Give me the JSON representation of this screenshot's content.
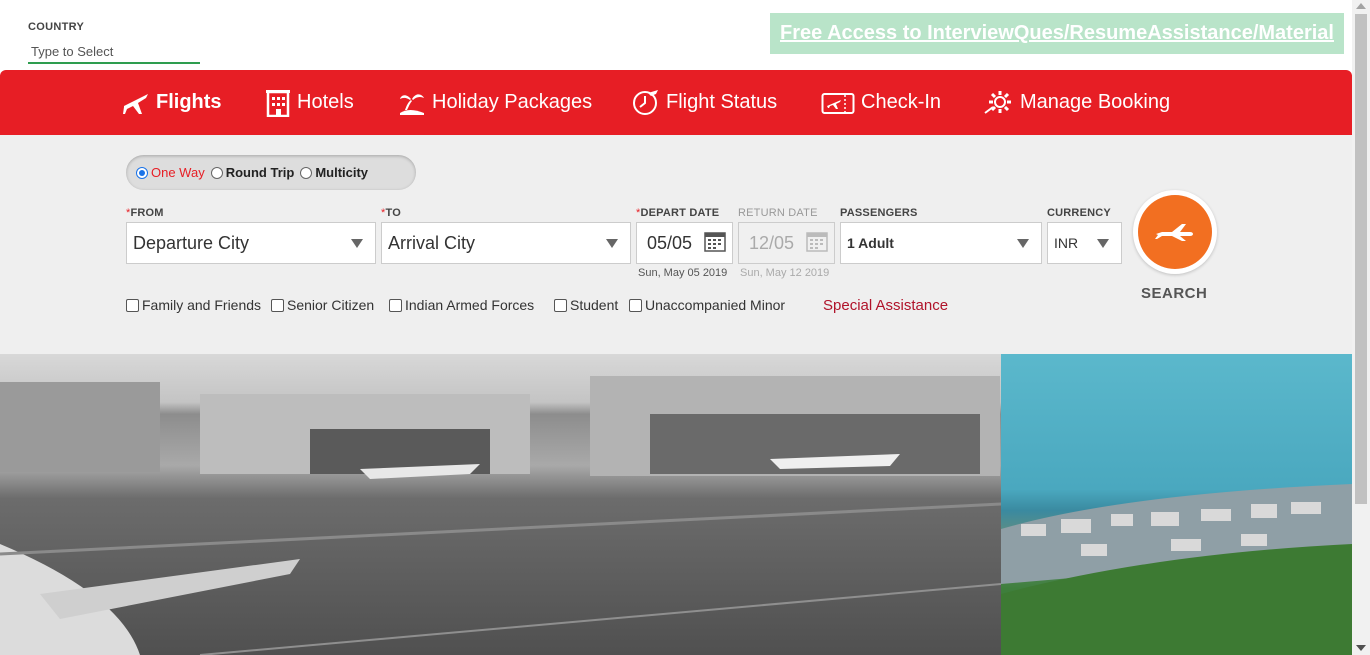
{
  "header": {
    "country_label": "COUNTRY",
    "country_placeholder": "Type to Select",
    "promo_link": "Free Access to InterviewQues/ResumeAssistance/Material"
  },
  "nav": {
    "items": [
      {
        "label": "Flights",
        "icon": "plane-icon",
        "active": true
      },
      {
        "label": "Hotels",
        "icon": "building-icon"
      },
      {
        "label": "Holiday Packages",
        "icon": "palm-tree-icon"
      },
      {
        "label": "Flight Status",
        "icon": "clock-plane-icon"
      },
      {
        "label": "Check-In",
        "icon": "ticket-icon"
      },
      {
        "label": "Manage Booking",
        "icon": "gear-icon"
      }
    ]
  },
  "trip_type": {
    "options": [
      "One Way",
      "Round Trip",
      "Multicity"
    ],
    "selected": "One Way"
  },
  "form": {
    "from_label": "FROM",
    "from_value": "Departure City",
    "to_label": "TO",
    "to_value": "Arrival City",
    "depart_label": "DEPART DATE",
    "depart_value": "05/05",
    "depart_sub": "Sun, May 05 2019",
    "return_label": "RETURN DATE",
    "return_value": "12/05",
    "return_sub": "Sun, May 12 2019",
    "passengers_label": "PASSENGERS",
    "passengers_value": "1 Adult",
    "currency_label": "CURRENCY",
    "currency_value": "INR",
    "required_mark": "*"
  },
  "checkboxes": [
    "Family and Friends",
    "Senior Citizen",
    "Indian Armed Forces",
    "Student",
    "Unaccompanied Minor"
  ],
  "special_assistance": "Special Assistance",
  "search_label": "SEARCH",
  "colors": {
    "brand_red": "#e71e25",
    "search_orange": "#f26f21",
    "promo_green": "#b9e4c9"
  }
}
